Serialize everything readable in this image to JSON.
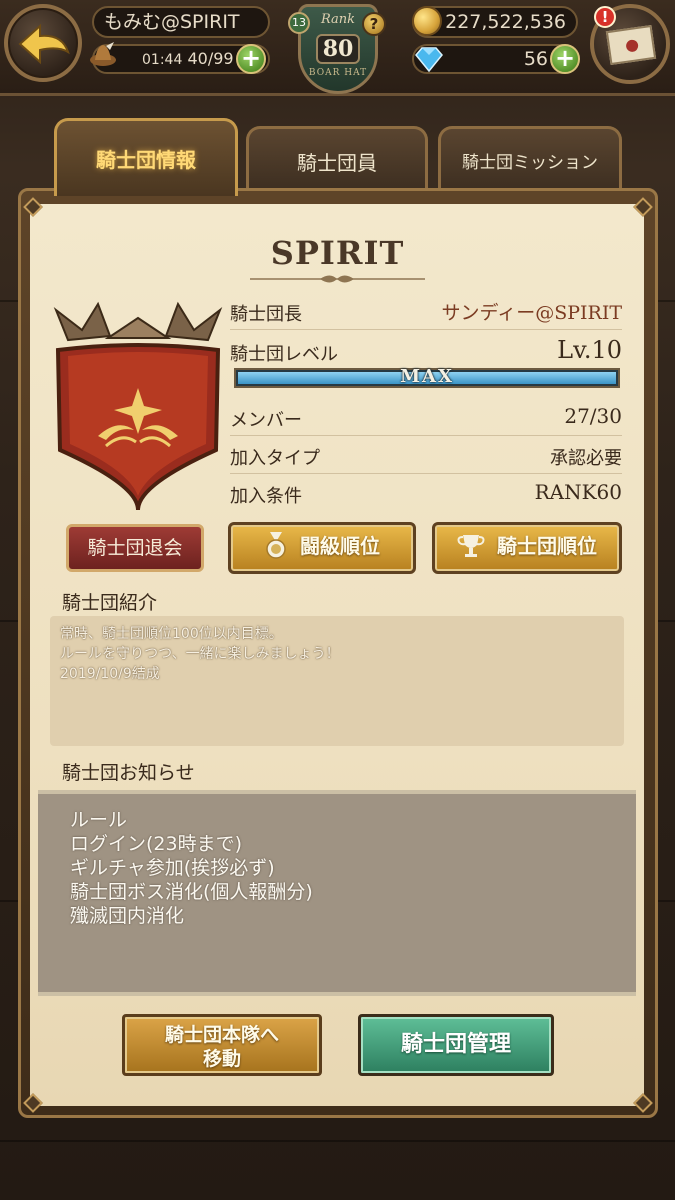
{
  "header": {
    "player_name": "もみむ@SPIRIT",
    "ap_timer": "01:44",
    "ap_value": "40/99",
    "rank_label": "Rank",
    "rank_value": "80",
    "rank_sub": "BOAR HAT",
    "rank_badge": "13",
    "help": "?",
    "gold": "227,522,536",
    "gems": "56",
    "alert": "!"
  },
  "tabs": [
    {
      "label": "騎士団情報",
      "active": true
    },
    {
      "label": "騎士団員",
      "active": false
    },
    {
      "label": "騎士団ミッション",
      "active": false
    }
  ],
  "guild": {
    "name": "SPIRIT",
    "rows": [
      {
        "label": "騎士団長",
        "value": "サンディー@SPIRIT"
      },
      {
        "label": "騎士団レベル",
        "value": "Lv.10"
      },
      {
        "label": "メンバー",
        "value": "27/30"
      },
      {
        "label": "加入タイプ",
        "value": "承認必要"
      },
      {
        "label": "加入条件",
        "value": "RANK60"
      }
    ],
    "level_bar_label": "MAX",
    "level_progress": 1.0
  },
  "buttons": {
    "leave": "騎士団退会",
    "fight_rank": "闘級順位",
    "guild_rank": "騎士団順位",
    "move": [
      "騎士団本隊へ",
      "移動"
    ],
    "manage": "騎士団管理"
  },
  "intro": {
    "title": "騎士団紹介",
    "lines": [
      "常時、騎士団順位100位以内目標。",
      "ルールを守りつつ、一緒に楽しみましょう！",
      "2019/10/9結成"
    ]
  },
  "notice": {
    "title": "騎士団お知らせ",
    "lines": [
      "ルール",
      "ログイン(23時まで)",
      "ギルチャ参加(挨拶必ず)",
      "騎士団ボス消化(個人報酬分)",
      "殲滅団内消化"
    ]
  },
  "colors": {
    "active_tab": "#ffd976",
    "leader_name": "#7b3b22",
    "level_bar": "#3a94c6",
    "manage_button": "#2d7f5f",
    "leave_button": "#9e3b35"
  },
  "icons": {
    "back": "back-arrow-icon",
    "ap": "hat-icon",
    "gold": "coin-icon",
    "gem": "diamond-icon",
    "mail": "mail-icon",
    "fight_rank": "medal-icon",
    "guild_rank": "trophy-icon"
  }
}
